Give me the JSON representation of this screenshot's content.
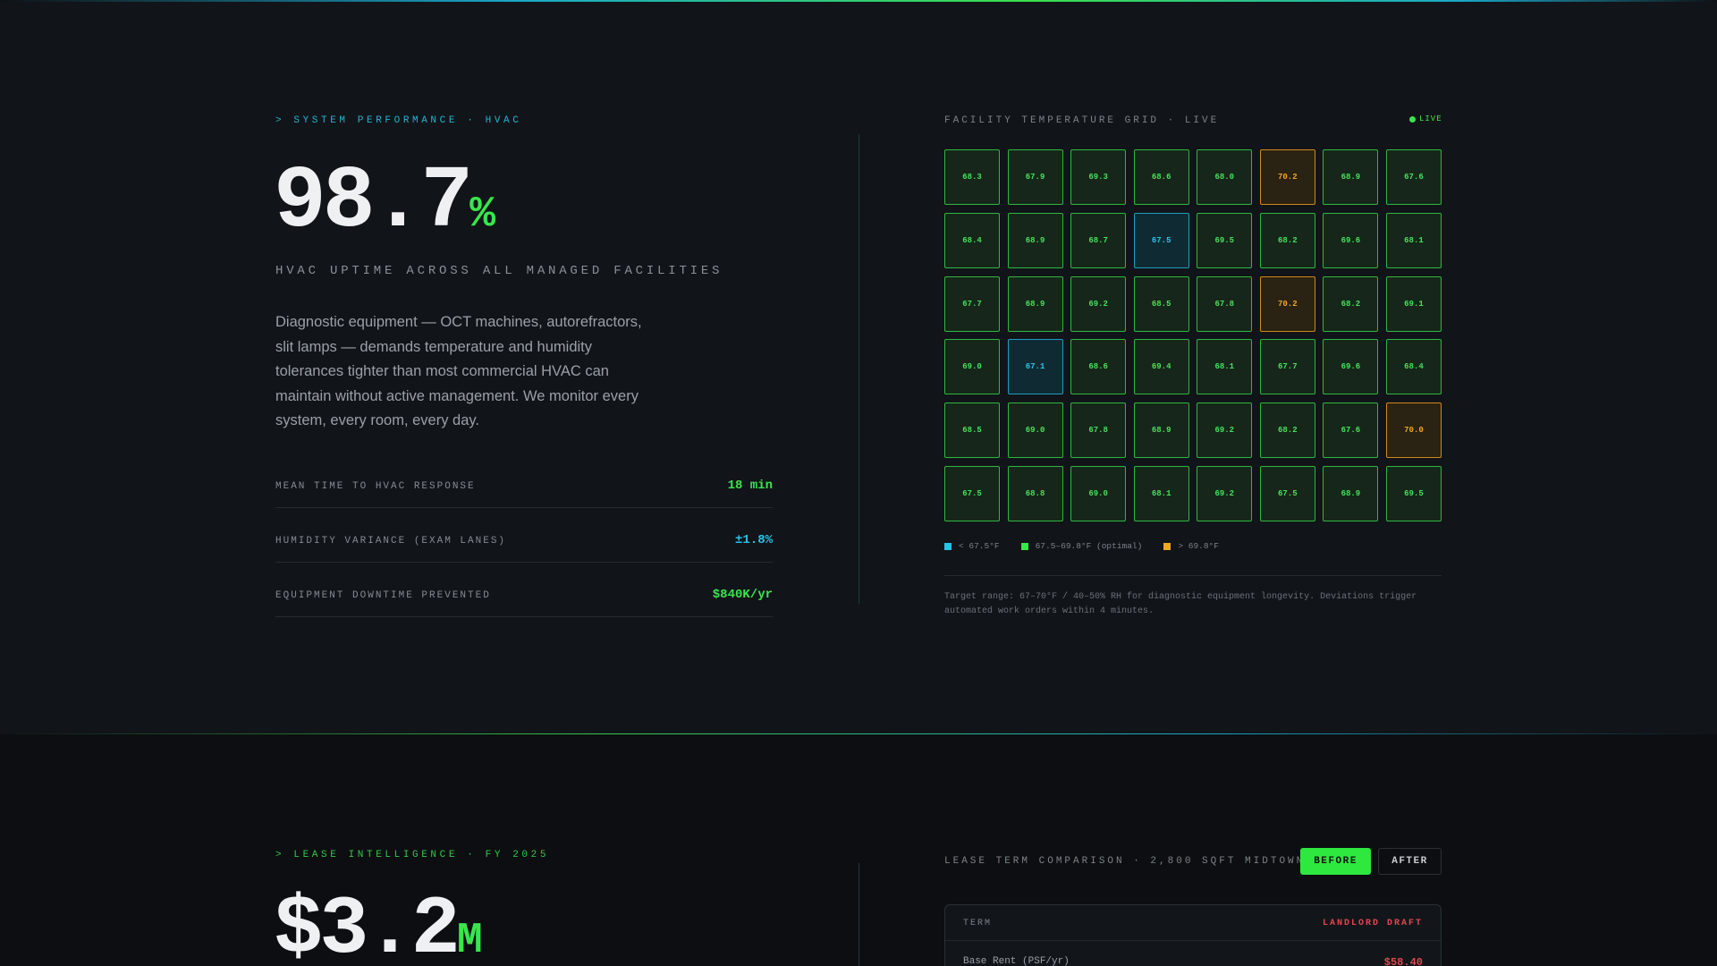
{
  "hvac": {
    "eyebrow": "> SYSTEM PERFORMANCE · HVAC",
    "big_value": "98.7",
    "big_unit": "%",
    "subtitle": "HVAC UPTIME ACROSS ALL MANAGED FACILITIES",
    "description": "Diagnostic equipment — OCT machines, autorefractors, slit lamps — demands temperature and humidity tolerances tighter than most commercial HVAC can maintain without active management. We monitor every system, every room, every day.",
    "metrics": [
      {
        "label": "MEAN TIME TO HVAC RESPONSE",
        "value": "18 min",
        "color": "green"
      },
      {
        "label": "HUMIDITY VARIANCE (EXAM LANES)",
        "value": "±1.8%",
        "color": "cyan"
      },
      {
        "label": "EQUIPMENT DOWNTIME PREVENTED",
        "value": "$840K/yr",
        "color": "green"
      }
    ]
  },
  "temperature_grid": {
    "title": "FACILITY TEMPERATURE GRID · LIVE",
    "live_label": "LIVE",
    "rows": [
      [
        "68.3",
        "67.9",
        "69.3",
        "68.6",
        "68.0",
        "70.2",
        "68.9",
        "67.6"
      ],
      [
        "68.4",
        "68.9",
        "68.7",
        "67.5",
        "69.5",
        "68.2",
        "69.6",
        "68.1"
      ],
      [
        "67.7",
        "68.9",
        "69.2",
        "68.5",
        "67.8",
        "70.2",
        "68.2",
        "69.1"
      ],
      [
        "69.0",
        "67.1",
        "68.6",
        "69.4",
        "68.1",
        "67.7",
        "69.6",
        "68.4"
      ],
      [
        "68.5",
        "69.0",
        "67.8",
        "68.9",
        "69.2",
        "68.2",
        "67.6",
        "70.0"
      ],
      [
        "67.5",
        "68.8",
        "69.0",
        "68.1",
        "69.2",
        "67.5",
        "68.9",
        "69.5"
      ]
    ],
    "cool_cells": [
      [
        1,
        3
      ],
      [
        3,
        1
      ]
    ],
    "warm_cells": [
      [
        0,
        5
      ],
      [
        2,
        5
      ],
      [
        4,
        7
      ]
    ],
    "legend": [
      {
        "label": "< 67.5°F",
        "swatch": "cool",
        "color": "#23c5e6"
      },
      {
        "label": "67.5–69.8°F (optimal)",
        "swatch": "opt",
        "color": "#39e64b"
      },
      {
        "label": "> 69.8°F",
        "swatch": "warm",
        "color": "#f0a526"
      }
    ],
    "note": "Target range: 67–70°F / 40–50% RH for diagnostic equipment longevity. Deviations trigger automated work orders within 4 minutes."
  },
  "lease": {
    "eyebrow": "> LEASE INTELLIGENCE · FY 2025",
    "big_value": "$3.2",
    "big_unit": "M",
    "comparison_title": "LEASE TERM COMPARISON · 2,800 SQFT MIDTOWN",
    "before_label": "BEFORE",
    "after_label": "AFTER",
    "table": {
      "col_term": "TERM",
      "col_draft": "LANDLORD DRAFT",
      "rows": [
        {
          "term": "Base Rent (PSF/yr)",
          "value": "$58.40"
        }
      ]
    }
  }
}
